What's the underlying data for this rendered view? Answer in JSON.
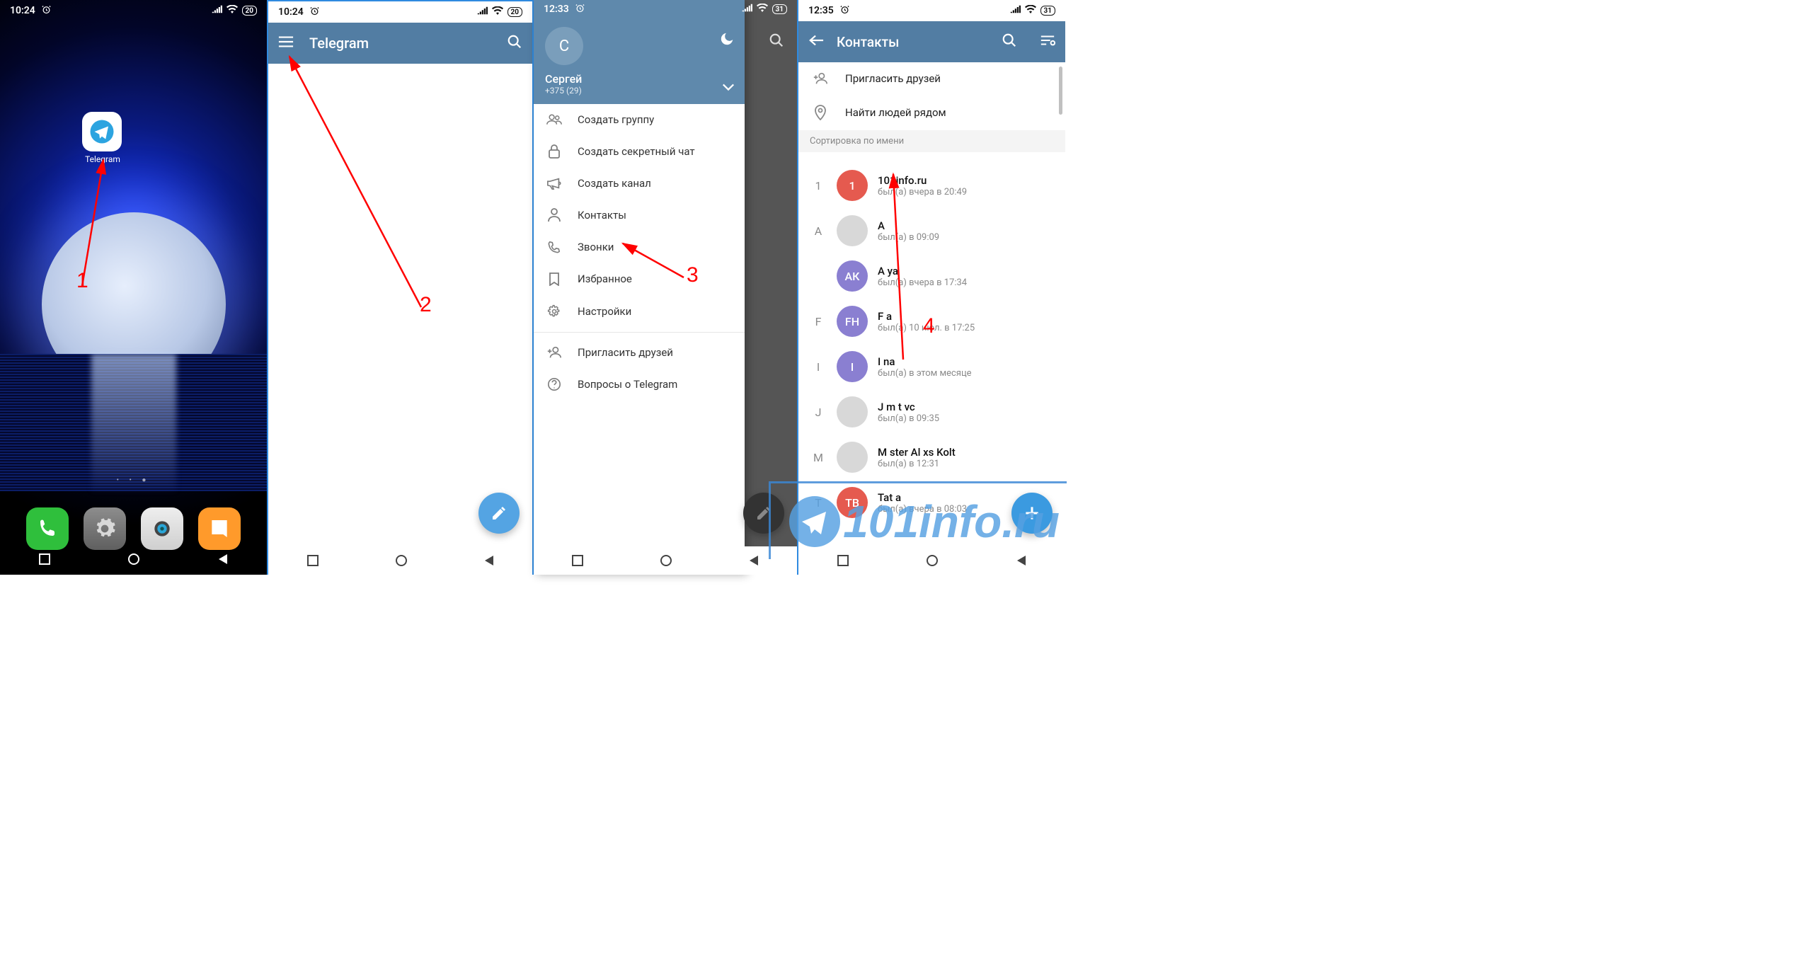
{
  "col1": {
    "time": "10:24",
    "battery": "20",
    "app_label": "Telegram",
    "annotation": "1"
  },
  "col2": {
    "time": "10:24",
    "battery": "20",
    "appbar_title": "Telegram",
    "annotation": "2"
  },
  "col3": {
    "time": "12:33",
    "battery": "31",
    "profile_initial": "С",
    "profile_name": "Сергей",
    "profile_phone": "+375 (29)",
    "menu": {
      "new_group": "Создать группу",
      "secret_chat": "Создать секретный чат",
      "new_channel": "Создать канал",
      "contacts": "Контакты",
      "calls": "Звонки",
      "saved": "Избранное",
      "settings": "Настройки",
      "invite": "Пригласить друзей",
      "faq": "Вопросы о Telegram"
    },
    "annotation": "3"
  },
  "col4": {
    "time": "12:35",
    "battery": "31",
    "title": "Контакты",
    "opt_invite": "Пригласить друзей",
    "opt_nearby": "Найти людей рядом",
    "sort_header": "Сортировка по имени",
    "annotation": "4",
    "contacts": [
      {
        "letter": "1",
        "initials": "1",
        "name": "101info.ru",
        "status": "был(а) вчера в 20:49",
        "color": "#e55a4f"
      },
      {
        "letter": "А",
        "initials": "",
        "name": "A",
        "status": "был(а) в 09:09",
        "color": "#d8d8d8"
      },
      {
        "letter": "",
        "initials": "АК",
        "name": "A           ya",
        "status": "был(а) вчера в 17:34",
        "color": "#8a7fd1"
      },
      {
        "letter": "F",
        "initials": "FH",
        "name": "F                 a",
        "status": "был(а) 10 июл. в 17:25",
        "color": "#8a7fd1"
      },
      {
        "letter": "I",
        "initials": "I",
        "name": "I   na",
        "status": "был(а) в этом месяце",
        "color": "#8a7fd1"
      },
      {
        "letter": "J",
        "initials": "",
        "name": "J m       t vc",
        "status": "был(а) в 09:35",
        "color": "#d8d8d8"
      },
      {
        "letter": "M",
        "initials": "",
        "name": "M  ster  Al xs     Kolt",
        "status": "был(а) в 12:31",
        "color": "#d8d8d8"
      },
      {
        "letter": "T",
        "initials": "ТВ",
        "name": "Tat         a",
        "status": "был(а) вчера в 08:03",
        "color": "#e55a4f"
      }
    ]
  },
  "watermark": "101info.ru"
}
